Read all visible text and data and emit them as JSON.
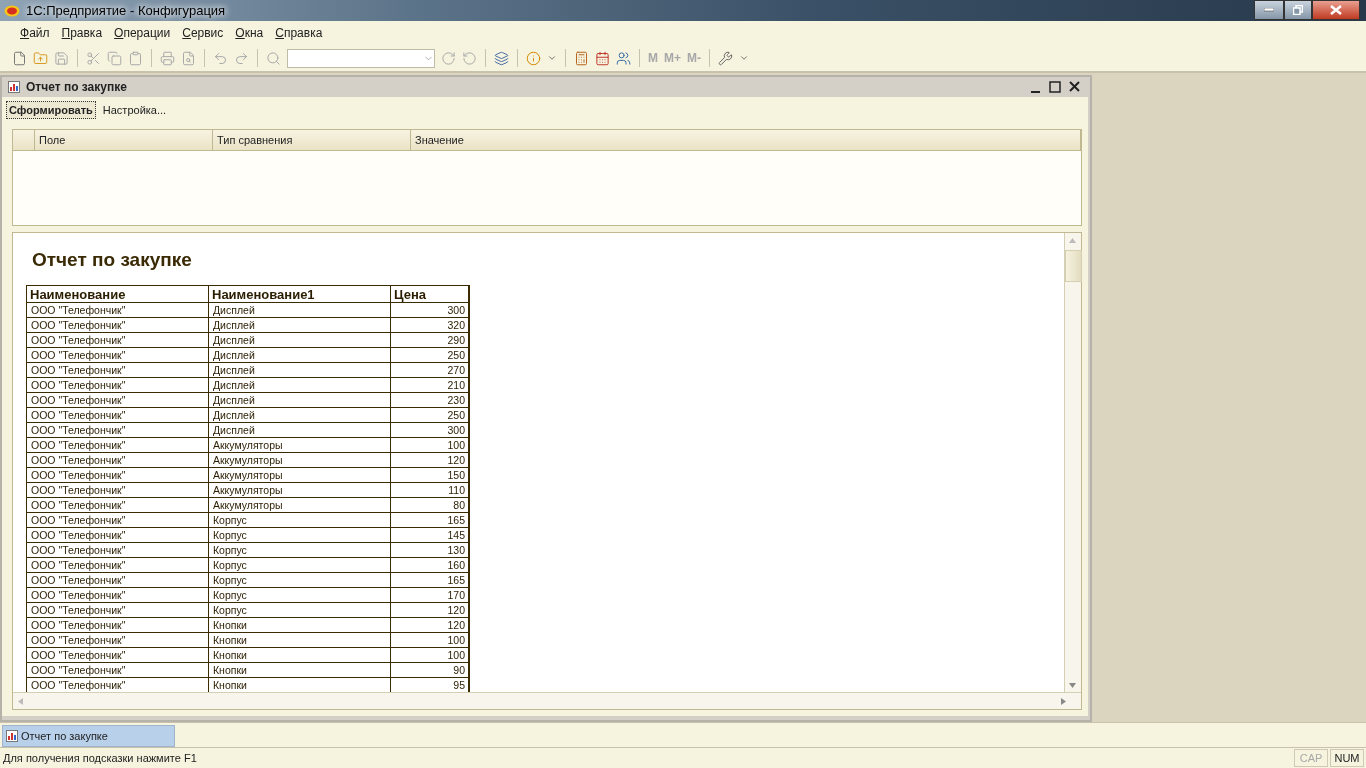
{
  "window": {
    "title": "1С:Предприятие - Конфигурация"
  },
  "menu": [
    {
      "label": "Файл"
    },
    {
      "label": "Правка"
    },
    {
      "label": "Операции"
    },
    {
      "label": "Сервис"
    },
    {
      "label": "Окна"
    },
    {
      "label": "Справка"
    }
  ],
  "toolbar": {
    "memory_buttons": [
      {
        "label": "M",
        "disabled": true
      },
      {
        "label": "M+",
        "disabled": true
      },
      {
        "label": "M-",
        "disabled": true
      }
    ]
  },
  "document_window": {
    "title": "Отчет по закупке",
    "commands": [
      {
        "label": "Сформировать",
        "selected": true
      },
      {
        "label": "Настройка...",
        "selected": false
      }
    ],
    "filter_table": {
      "columns": [
        "Поле",
        "Тип сравнения",
        "Значение"
      ]
    },
    "report": {
      "title": "Отчет по закупке",
      "columns": [
        "Наименование",
        "Наименование1",
        "Цена"
      ],
      "rows": [
        [
          "ООО \"Телефончик\"",
          "Дисплей",
          "300"
        ],
        [
          "ООО \"Телефончик\"",
          "Дисплей",
          "320"
        ],
        [
          "ООО \"Телефончик\"",
          "Дисплей",
          "290"
        ],
        [
          "ООО \"Телефончик\"",
          "Дисплей",
          "250"
        ],
        [
          "ООО \"Телефончик\"",
          "Дисплей",
          "270"
        ],
        [
          "ООО \"Телефончик\"",
          "Дисплей",
          "210"
        ],
        [
          "ООО \"Телефончик\"",
          "Дисплей",
          "230"
        ],
        [
          "ООО \"Телефончик\"",
          "Дисплей",
          "250"
        ],
        [
          "ООО \"Телефончик\"",
          "Дисплей",
          "300"
        ],
        [
          "ООО \"Телефончик\"",
          "Аккумуляторы",
          "100"
        ],
        [
          "ООО \"Телефончик\"",
          "Аккумуляторы",
          "120"
        ],
        [
          "ООО \"Телефончик\"",
          "Аккумуляторы",
          "150"
        ],
        [
          "ООО \"Телефончик\"",
          "Аккумуляторы",
          "110"
        ],
        [
          "ООО \"Телефончик\"",
          "Аккумуляторы",
          "80"
        ],
        [
          "ООО \"Телефончик\"",
          "Корпус",
          "165"
        ],
        [
          "ООО \"Телефончик\"",
          "Корпус",
          "145"
        ],
        [
          "ООО \"Телефончик\"",
          "Корпус",
          "130"
        ],
        [
          "ООО \"Телефончик\"",
          "Корпус",
          "160"
        ],
        [
          "ООО \"Телефончик\"",
          "Корпус",
          "165"
        ],
        [
          "ООО \"Телефончик\"",
          "Корпус",
          "170"
        ],
        [
          "ООО \"Телефончик\"",
          "Корпус",
          "120"
        ],
        [
          "ООО \"Телефончик\"",
          "Кнопки",
          "120"
        ],
        [
          "ООО \"Телефончик\"",
          "Кнопки",
          "100"
        ],
        [
          "ООО \"Телефончик\"",
          "Кнопки",
          "100"
        ],
        [
          "ООО \"Телефончик\"",
          "Кнопки",
          "90"
        ],
        [
          "ООО \"Телефончик\"",
          "Кнопки",
          "95"
        ]
      ]
    }
  },
  "taskbar": [
    {
      "label": "Отчет по закупке",
      "selected": true
    }
  ],
  "status_bar": {
    "hint": "Для получения подсказки нажмите F1",
    "indicators": [
      {
        "label": "CAP",
        "on": false
      },
      {
        "label": "NUM",
        "on": true
      }
    ]
  }
}
